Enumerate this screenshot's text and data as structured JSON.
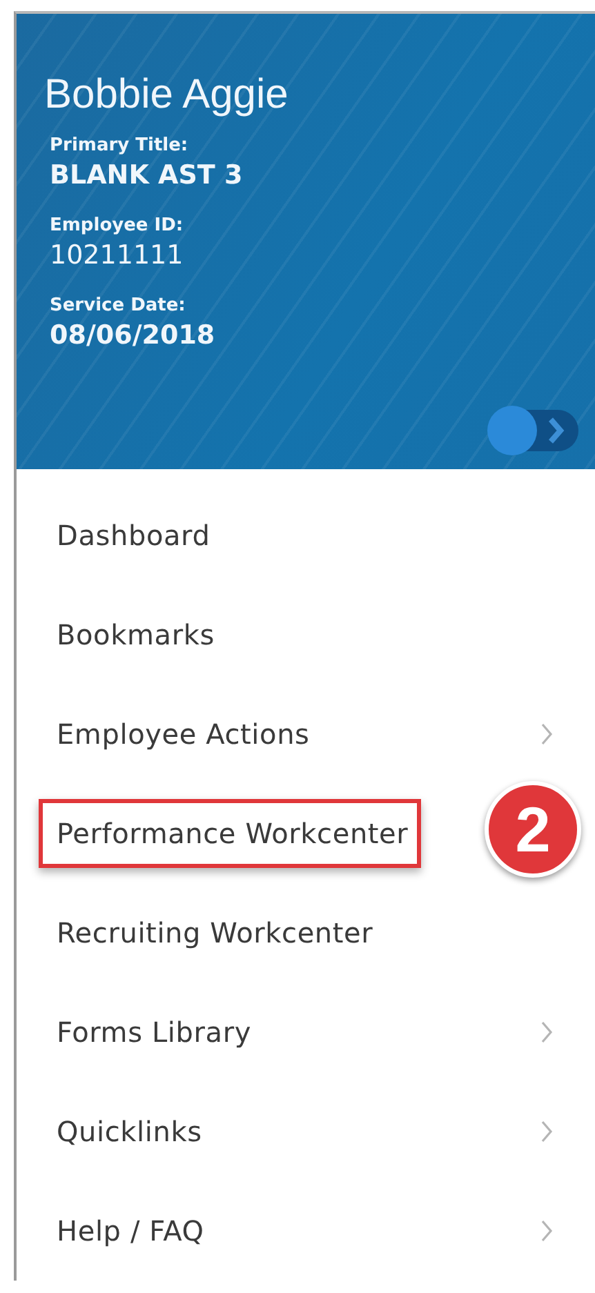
{
  "profile": {
    "name": "Bobbie Aggie",
    "fields": [
      {
        "label": "Primary Title:",
        "value": "BLANK AST 3"
      },
      {
        "label": "Employee ID:",
        "value": "10211111"
      },
      {
        "label": "Service Date:",
        "value": "08/06/2018"
      }
    ]
  },
  "menu": [
    {
      "label": "Dashboard",
      "submenu": false,
      "highlighted": false
    },
    {
      "label": "Bookmarks",
      "submenu": false,
      "highlighted": false
    },
    {
      "label": "Employee Actions",
      "submenu": true,
      "highlighted": false
    },
    {
      "label": "Performance Workcenter",
      "submenu": false,
      "highlighted": true,
      "callout": "2"
    },
    {
      "label": "Recruiting Workcenter",
      "submenu": false,
      "highlighted": false
    },
    {
      "label": "Forms Library",
      "submenu": true,
      "highlighted": false
    },
    {
      "label": "Quicklinks",
      "submenu": true,
      "highlighted": false
    },
    {
      "label": "Help / FAQ",
      "submenu": true,
      "highlighted": false
    }
  ]
}
